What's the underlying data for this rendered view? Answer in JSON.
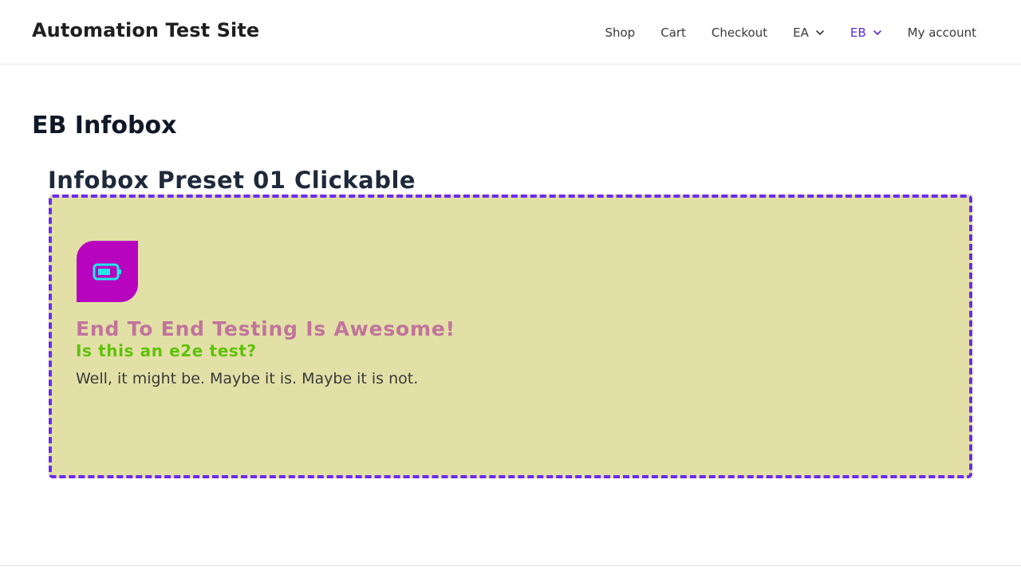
{
  "header": {
    "site_title": "Automation Test Site",
    "nav": [
      {
        "label": "Shop"
      },
      {
        "label": "Cart"
      },
      {
        "label": "Checkout"
      },
      {
        "label": "EA",
        "has_dropdown": true
      },
      {
        "label": "EB",
        "has_dropdown": true,
        "active": true
      },
      {
        "label": "My account"
      }
    ]
  },
  "page": {
    "title": "EB Infobox",
    "section_heading": "Infobox Preset 01 Clickable"
  },
  "infobox": {
    "icon": "battery-half-icon",
    "title": "End To End Testing Is Awesome!",
    "subtitle": "Is this an e2e test?",
    "text": "Well, it might be. Maybe it is. Maybe it is not."
  },
  "colors": {
    "accent": "#5b2ad6",
    "infobox_background": "#e2e0a6",
    "infobox_border": "#6b2bf0",
    "icon_background": "#b705bf",
    "icon_color": "#1de9e9",
    "title_color": "#c1749c",
    "subtitle_color": "#5fc20a"
  }
}
